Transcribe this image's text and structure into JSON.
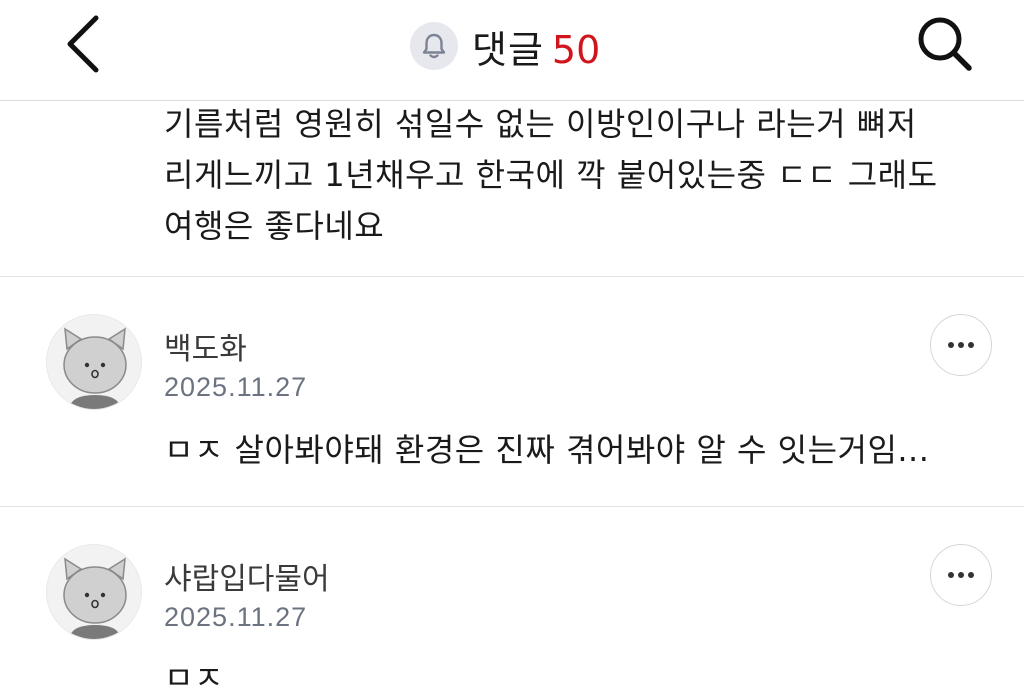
{
  "header": {
    "title": "댓글",
    "count": "50",
    "count_color": "#d0161c",
    "back_icon": "chevron-left-icon",
    "bell_icon": "bell-icon",
    "search_icon": "search-icon"
  },
  "top_comment": {
    "lines": [
      "기름처럼 영원히 섞일수 없는 이방인이구나 라는거 뼈저",
      "리게느끼고 1년채우고 한국에 깍 붙어있는중 ㄷㄷ 그래도",
      "여행은 좋다네요"
    ]
  },
  "comments": [
    {
      "username": "백도화",
      "date": "2025.11.27",
      "text": "ㅁㅈ 살아봐야돼 환경은 진짜 겪어봐야 알 수 잇는거임...",
      "more_icon": "more-horizontal-icon"
    },
    {
      "username": "샤랍입다물어",
      "date": "2025.11.27",
      "text": "ㅁㅈ",
      "more_icon": "more-horizontal-icon"
    }
  ]
}
